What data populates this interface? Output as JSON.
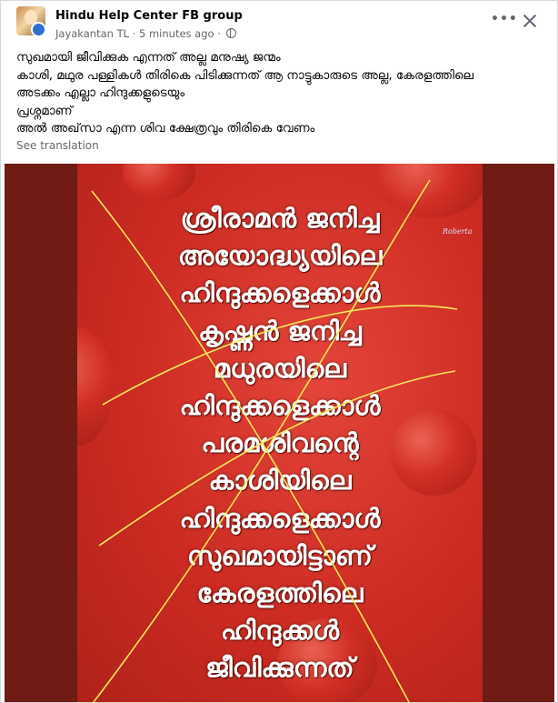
{
  "post": {
    "group_name": "Hindu Help Center FB group",
    "author": "Jayakantan TL",
    "separator": "·",
    "time": "5 minutes ago",
    "separator2": "·",
    "body_lines": [
      "സുഖമായി ജീവിക്കുക എന്നത് അല്ല മനുഷ്യ ജന്മം",
      "കാശി, മഥുര പള്ളികൾ തിരികെ പിടിക്കുന്നത് ആ നാട്ടുകാരുടെ അല്ല, കേരളത്തിലെ",
      "അടക്കം എല്ലാ ഹിന്ദുക്കളുടെയും",
      "പ്രശ്നമാണ്",
      "അൽ അഖ്‌സാ എന്ന ശിവ ക്ഷേത്രവും തിരികെ വേണം"
    ],
    "see_translation": "See translation"
  },
  "poster": {
    "lines": [
      "ശ്രീരാമൻ ജനിച്ച",
      "അയോദ്ധ്യയിലെ",
      "ഹിന്ദുക്കളെക്കാൾ",
      "കൃഷ്ണൻ ജനിച്ച",
      "മധുരയിലെ",
      "ഹിന്ദുക്കളെക്കാൾ",
      "പരമശിവന്റെ",
      "കാശിയിലെ",
      "ഹിന്ദുക്കളെക്കാൾ",
      "സുഖമായിട്ടാണ്",
      "കേരളത്തിലെ",
      "ഹിന്ദുക്കൾ",
      "ജീവിക്കുന്നത്"
    ],
    "watermark": "Roberta",
    "overlay_color": "#f2e85a",
    "background_color": "#cc2b22"
  },
  "icons": {
    "more": "more-options-icon",
    "close": "close-icon",
    "globe": "globe-icon"
  }
}
